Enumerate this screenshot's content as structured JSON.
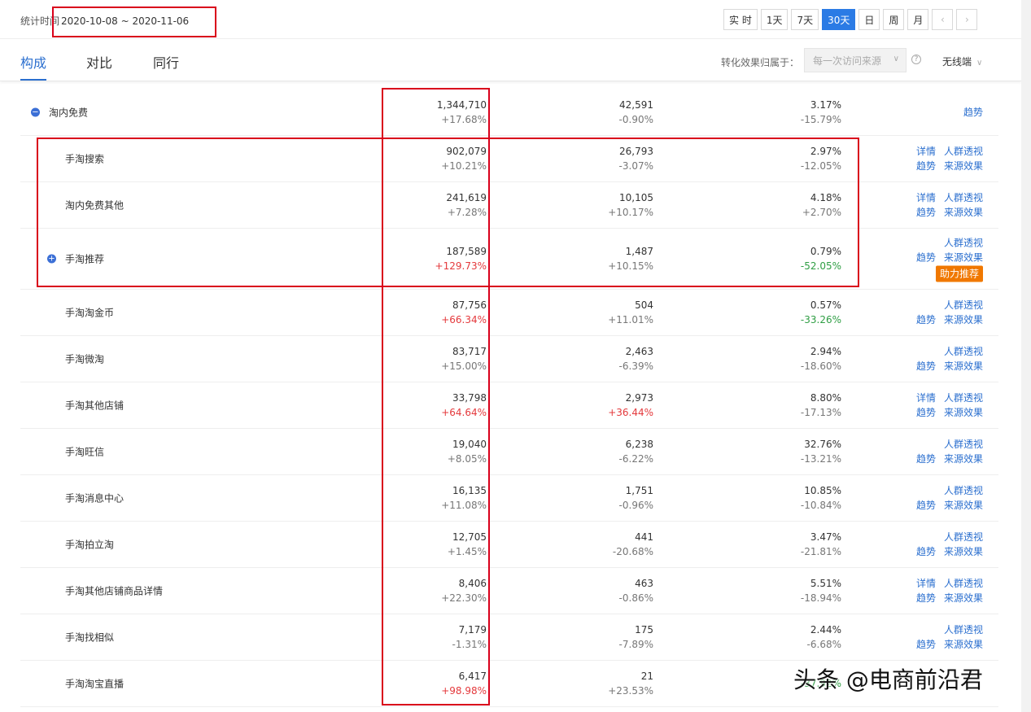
{
  "header": {
    "date_label": "统计时间",
    "date_range": "2020-10-08 ~ 2020-11-06",
    "periods": [
      "实 时",
      "1天",
      "7天",
      "30天",
      "日",
      "周",
      "月"
    ],
    "active_period": "30天",
    "prev_icon": "chevron-left-icon",
    "next_icon": "chevron-right-icon"
  },
  "tabs": {
    "items": [
      "构成",
      "对比",
      "同行"
    ],
    "active": "构成",
    "attribution_label": "转化效果归属于：",
    "attribution_value": "每一次访问来源",
    "device_value": "无线端"
  },
  "rows": [
    {
      "name": "淘内免费",
      "toggle": "−",
      "v1": "1,344,710",
      "c1": "+17.68%",
      "v2": "42,591",
      "c2": "-0.90%",
      "v3": "3.17%",
      "c3": "-15.79%",
      "a1": "",
      "a2": "",
      "a3": "",
      "a4": "趋势",
      "badge": ""
    },
    {
      "name": "手淘搜索",
      "toggle": "",
      "v1": "902,079",
      "c1": "+10.21%",
      "v2": "26,793",
      "c2": "-3.07%",
      "v3": "2.97%",
      "c3": "-12.05%",
      "a1": "详情",
      "a2": "人群透视",
      "a3": "趋势",
      "a4": "来源效果",
      "badge": ""
    },
    {
      "name": "淘内免费其他",
      "toggle": "",
      "v1": "241,619",
      "c1": "+7.28%",
      "v2": "10,105",
      "c2": "+10.17%",
      "v3": "4.18%",
      "c3": "+2.70%",
      "a1": "详情",
      "a2": "人群透视",
      "a3": "趋势",
      "a4": "来源效果",
      "badge": ""
    },
    {
      "name": "手淘推荐",
      "toggle": "+",
      "v1": "187,589",
      "c1": "+129.73%",
      "v2": "1,487",
      "c2": "+10.15%",
      "v3": "0.79%",
      "c3": "-52.05%",
      "a1": "",
      "a2": "人群透视",
      "a3": "趋势",
      "a4": "来源效果",
      "badge": "助力推荐"
    },
    {
      "name": "手淘淘金币",
      "toggle": "",
      "v1": "87,756",
      "c1": "+66.34%",
      "v2": "504",
      "c2": "+11.01%",
      "v3": "0.57%",
      "c3": "-33.26%",
      "a1": "",
      "a2": "人群透视",
      "a3": "趋势",
      "a4": "来源效果",
      "badge": ""
    },
    {
      "name": "手淘微淘",
      "toggle": "",
      "v1": "83,717",
      "c1": "+15.00%",
      "v2": "2,463",
      "c2": "-6.39%",
      "v3": "2.94%",
      "c3": "-18.60%",
      "a1": "",
      "a2": "人群透视",
      "a3": "趋势",
      "a4": "来源效果",
      "badge": ""
    },
    {
      "name": "手淘其他店铺",
      "toggle": "",
      "v1": "33,798",
      "c1": "+64.64%",
      "v2": "2,973",
      "c2": "+36.44%",
      "v3": "8.80%",
      "c3": "-17.13%",
      "a1": "详情",
      "a2": "人群透视",
      "a3": "趋势",
      "a4": "来源效果",
      "badge": ""
    },
    {
      "name": "手淘旺信",
      "toggle": "",
      "v1": "19,040",
      "c1": "+8.05%",
      "v2": "6,238",
      "c2": "-6.22%",
      "v3": "32.76%",
      "c3": "-13.21%",
      "a1": "",
      "a2": "人群透视",
      "a3": "趋势",
      "a4": "来源效果",
      "badge": ""
    },
    {
      "name": "手淘消息中心",
      "toggle": "",
      "v1": "16,135",
      "c1": "+11.08%",
      "v2": "1,751",
      "c2": "-0.96%",
      "v3": "10.85%",
      "c3": "-10.84%",
      "a1": "",
      "a2": "人群透视",
      "a3": "趋势",
      "a4": "来源效果",
      "badge": ""
    },
    {
      "name": "手淘拍立淘",
      "toggle": "",
      "v1": "12,705",
      "c1": "+1.45%",
      "v2": "441",
      "c2": "-20.68%",
      "v3": "3.47%",
      "c3": "-21.81%",
      "a1": "",
      "a2": "人群透视",
      "a3": "趋势",
      "a4": "来源效果",
      "badge": ""
    },
    {
      "name": "手淘其他店铺商品详情",
      "toggle": "",
      "v1": "8,406",
      "c1": "+22.30%",
      "v2": "463",
      "c2": "-0.86%",
      "v3": "5.51%",
      "c3": "-18.94%",
      "a1": "详情",
      "a2": "人群透视",
      "a3": "趋势",
      "a4": "来源效果",
      "badge": ""
    },
    {
      "name": "手淘找相似",
      "toggle": "",
      "v1": "7,179",
      "c1": "-1.31%",
      "v2": "175",
      "c2": "-7.89%",
      "v3": "2.44%",
      "c3": "-6.68%",
      "a1": "",
      "a2": "人群透视",
      "a3": "趋势",
      "a4": "来源效果",
      "badge": ""
    },
    {
      "name": "手淘淘宝直播",
      "toggle": "",
      "v1": "6,417",
      "c1": "+98.98%",
      "v2": "21",
      "c2": "+23.53%",
      "v3": "",
      "c3": "-37.92%",
      "a1": "",
      "a2": "",
      "a3": "",
      "a4": "",
      "badge": ""
    }
  ],
  "colors": {
    "accent": "#2b6fcf",
    "up_red": "#e4393c",
    "down_green": "#2f9e44",
    "badge_orange": "#f07800",
    "annotation_red": "#d9001b"
  },
  "watermark": "头条 @电商前沿君"
}
